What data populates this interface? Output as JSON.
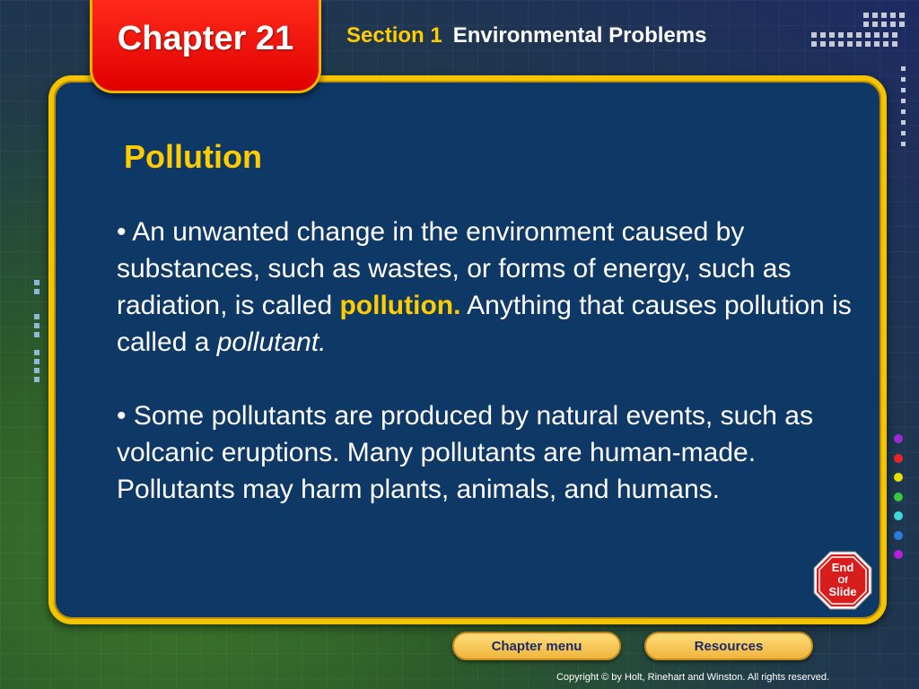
{
  "header": {
    "chapter": "Chapter 21",
    "section_number": "Section 1",
    "section_title": "Environmental Problems"
  },
  "slide": {
    "title": "Pollution",
    "bullet1": {
      "marker": "•",
      "text_before": "An unwanted change in the environment caused by substances, such as wastes, or forms of energy, such as radiation, is called",
      "term": "pollution.",
      "text_middle": "Anything that causes pollution is called a",
      "italic_term": "pollutant."
    },
    "bullet2": {
      "marker": "•",
      "text": "Some pollutants are produced by natural events, such as volcanic eruptions. Many pollutants are human-made. Pollutants may harm plants, animals, and humans."
    }
  },
  "end_slide": {
    "line1": "End",
    "line2": "Of",
    "line3": "Slide"
  },
  "navigation": {
    "chapter_menu": "Chapter menu",
    "resources": "Resources"
  },
  "footer": {
    "copyright": "Copyright © by Holt, Rinehart and Winston. All rights reserved."
  },
  "colors": {
    "panel": "#0e3866",
    "border": "#f4c400",
    "accent_text": "#ffcc00",
    "chapter_tab": "#e00000",
    "dots": [
      "#9a2cd8",
      "#e8262a",
      "#e8e000",
      "#3ac93a",
      "#40d8d8",
      "#2a7ce0",
      "#b520d8"
    ]
  }
}
